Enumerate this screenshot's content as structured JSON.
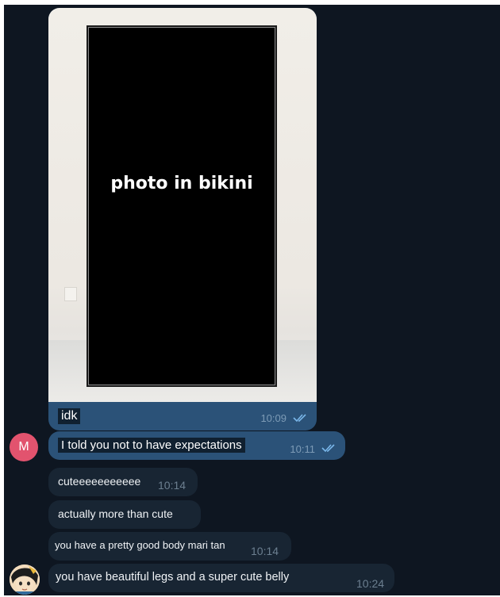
{
  "photo_message": {
    "censor_label": "photo in bikini",
    "caption": "idk",
    "time": "10:09",
    "status": "read"
  },
  "sender_avatar_initial": "M",
  "outgoing_messages": [
    {
      "text": "I told you not to have expectations",
      "time": "10:11",
      "status": "read"
    }
  ],
  "incoming_messages": [
    {
      "text": "cuteeeeeeeeeee",
      "time": "10:14"
    },
    {
      "text": "actually more than cute",
      "time": ""
    },
    {
      "text": "you have a pretty good body mari tan",
      "time": "10:14"
    },
    {
      "text": "you have beautiful legs and a super cute belly",
      "time": "10:24"
    }
  ],
  "colors": {
    "chat_background": "#0e1621",
    "outgoing_bubble": "#2b5278",
    "incoming_bubble": "#182533",
    "avatar_m": "#e2536e",
    "read_check": "#7ab7ea"
  }
}
